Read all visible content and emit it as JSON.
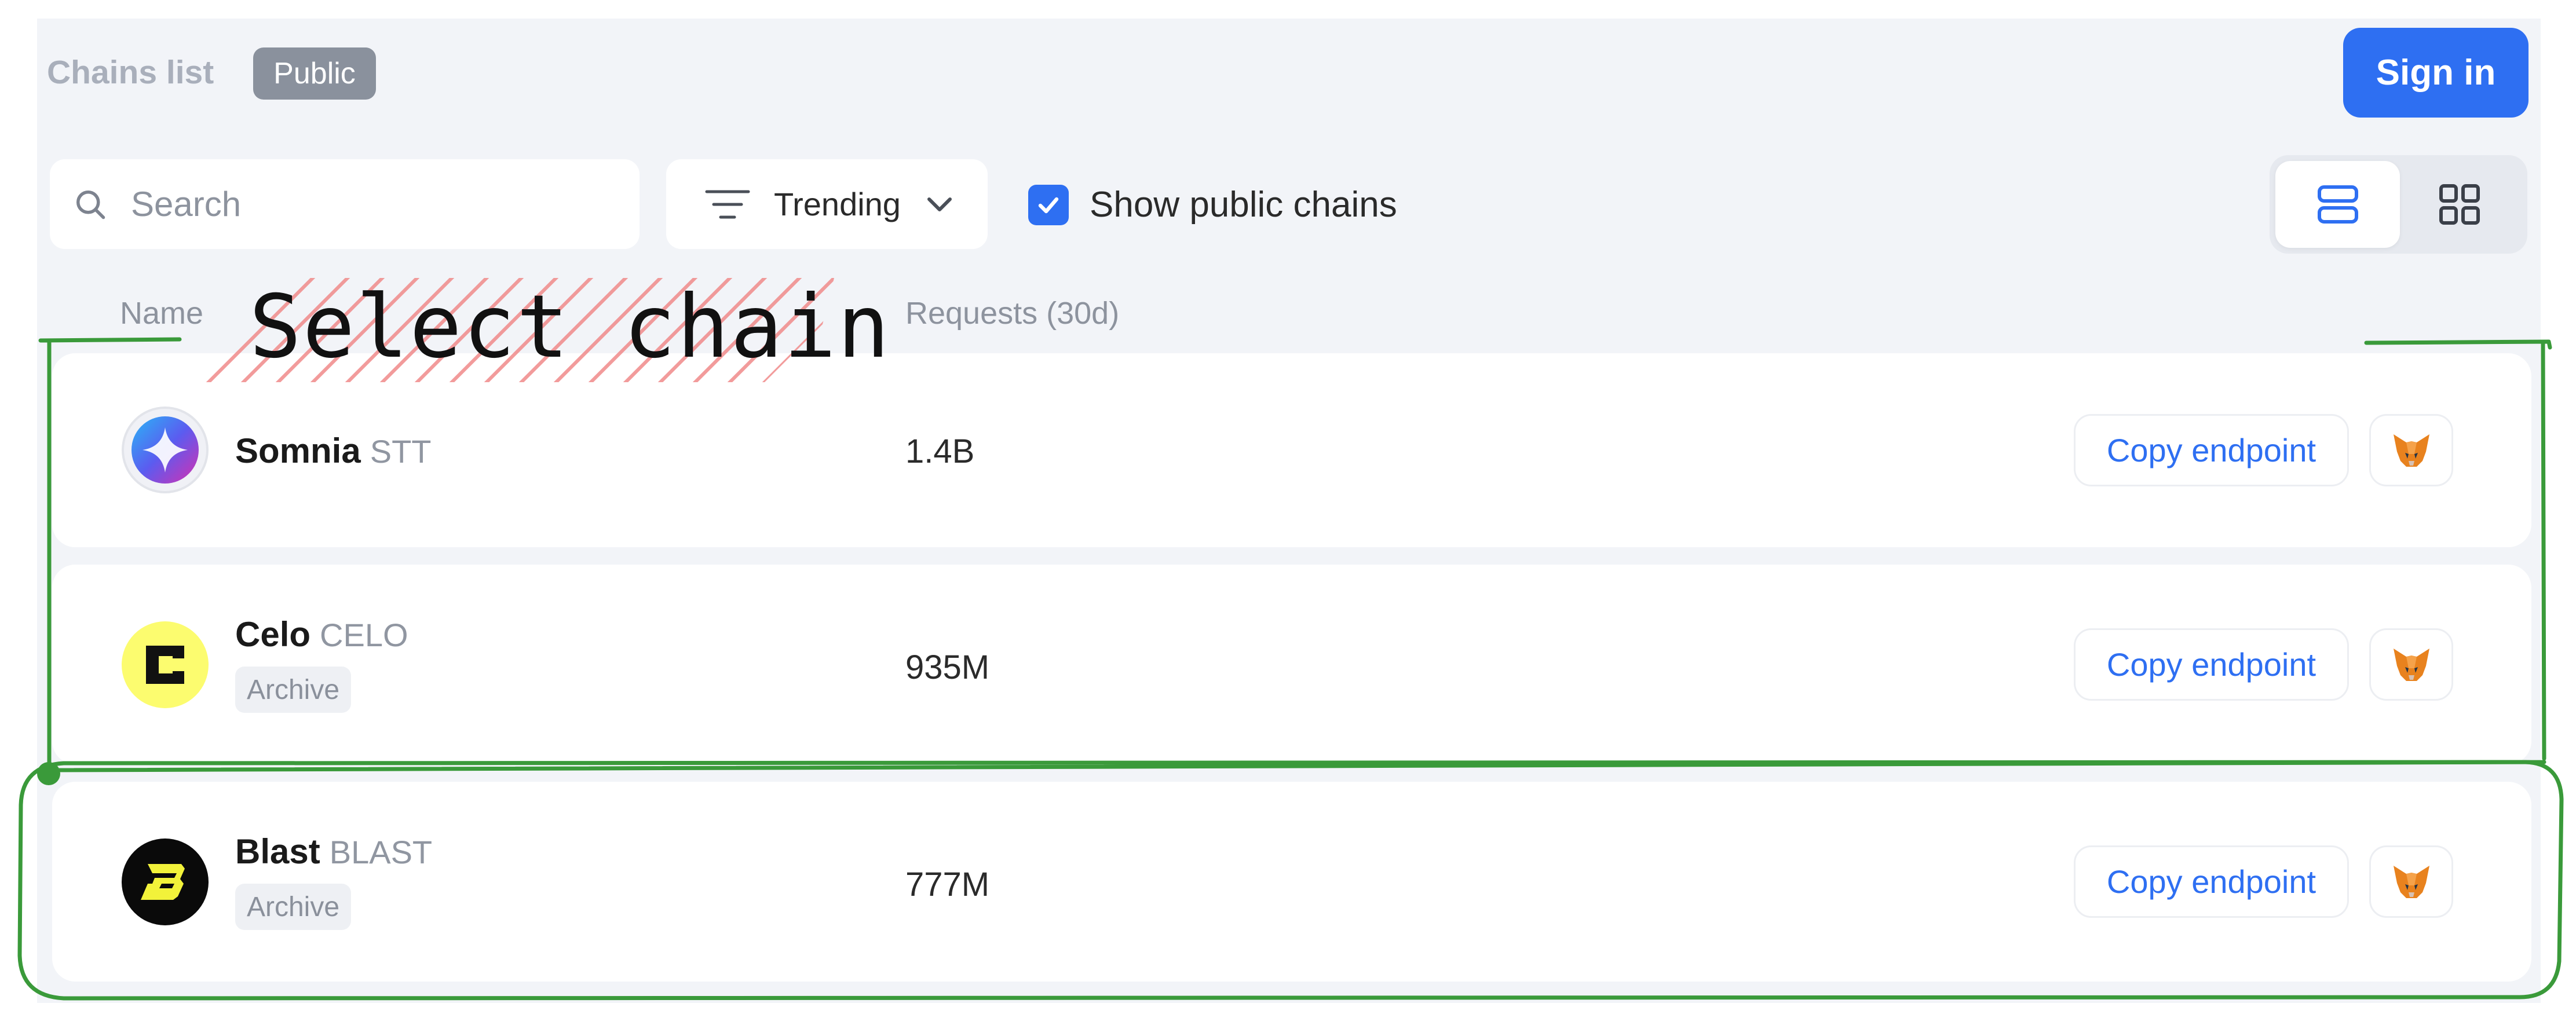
{
  "header": {
    "title": "Chains list",
    "badge": "Public",
    "signin_label": "Sign in"
  },
  "toolbar": {
    "search_placeholder": "Search",
    "sort_label": "Trending",
    "show_public_label": "Show public chains",
    "show_public_checked": true,
    "view_mode": "list"
  },
  "columns": {
    "name": "Name",
    "requests": "Requests (30d)"
  },
  "chains": [
    {
      "name": "Somnia",
      "symbol": "STT",
      "archive": "",
      "requests": "1.4B",
      "copy_label": "Copy endpoint",
      "logo": "somnia-logo"
    },
    {
      "name": "Celo",
      "symbol": "CELO",
      "archive": "Archive",
      "requests": "935M",
      "copy_label": "Copy endpoint",
      "logo": "celo-logo"
    },
    {
      "name": "Blast",
      "symbol": "BLAST",
      "archive": "Archive",
      "requests": "777M",
      "copy_label": "Copy endpoint",
      "logo": "blast-logo"
    }
  ],
  "annotation": {
    "label": "Select chain",
    "color": "#3a9a3a",
    "hatch_color": "#f08080"
  },
  "colors": {
    "accent": "#2e6ff2",
    "panel_bg": "#f2f4f8",
    "badge_bg": "#8a919d"
  }
}
